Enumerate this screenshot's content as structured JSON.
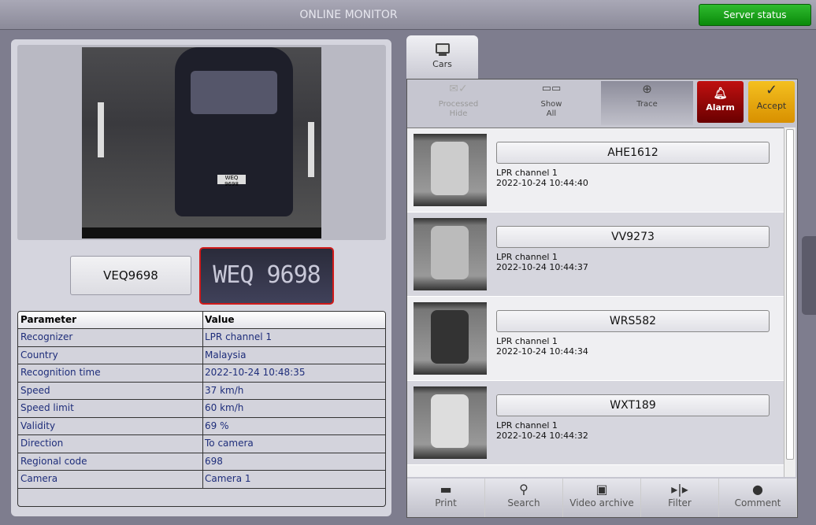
{
  "header": {
    "title": "ONLINE MONITOR",
    "server_status": "Server status"
  },
  "event": {
    "plate": "VEQ9698",
    "plate_crop_text": "WEQ 9698",
    "car_plate_text": "WEQ 9698",
    "table": {
      "headers": [
        "Parameter",
        "Value"
      ],
      "rows": [
        [
          "Recognizer",
          "LPR channel  1"
        ],
        [
          "Country",
          "Malaysia"
        ],
        [
          "Recognition time",
          "2022-10-24 10:48:35"
        ],
        [
          "Speed",
          "37 km/h"
        ],
        [
          "Speed limit",
          "60 km/h"
        ],
        [
          "Validity",
          "69 %"
        ],
        [
          "Direction",
          "To camera"
        ],
        [
          "Regional code",
          "698"
        ],
        [
          "Camera",
          "Camera 1"
        ]
      ]
    }
  },
  "tabs": [
    {
      "label": "Cars",
      "icon": "monitor-icon"
    }
  ],
  "toolbar": {
    "processed_hide": "Processed\nHide",
    "show_all": "Show\nAll",
    "trace": "Trace",
    "alarm": "Alarm",
    "accept": "Accept"
  },
  "list": [
    {
      "plate": "AHE1612",
      "channel": "LPR channel  1",
      "time": "2022-10-24 10:44:40"
    },
    {
      "plate": "VV9273",
      "channel": "LPR channel  1",
      "time": "2022-10-24 10:44:37"
    },
    {
      "plate": "WRS582",
      "channel": "LPR channel  1",
      "time": "2022-10-24 10:44:34"
    },
    {
      "plate": "WXT189",
      "channel": "LPR channel  1",
      "time": "2022-10-24 10:44:32"
    }
  ],
  "bottom": {
    "print": "Print",
    "search": "Search",
    "video_archive": "Video archive",
    "filter": "Filter",
    "comment": "Comment"
  }
}
